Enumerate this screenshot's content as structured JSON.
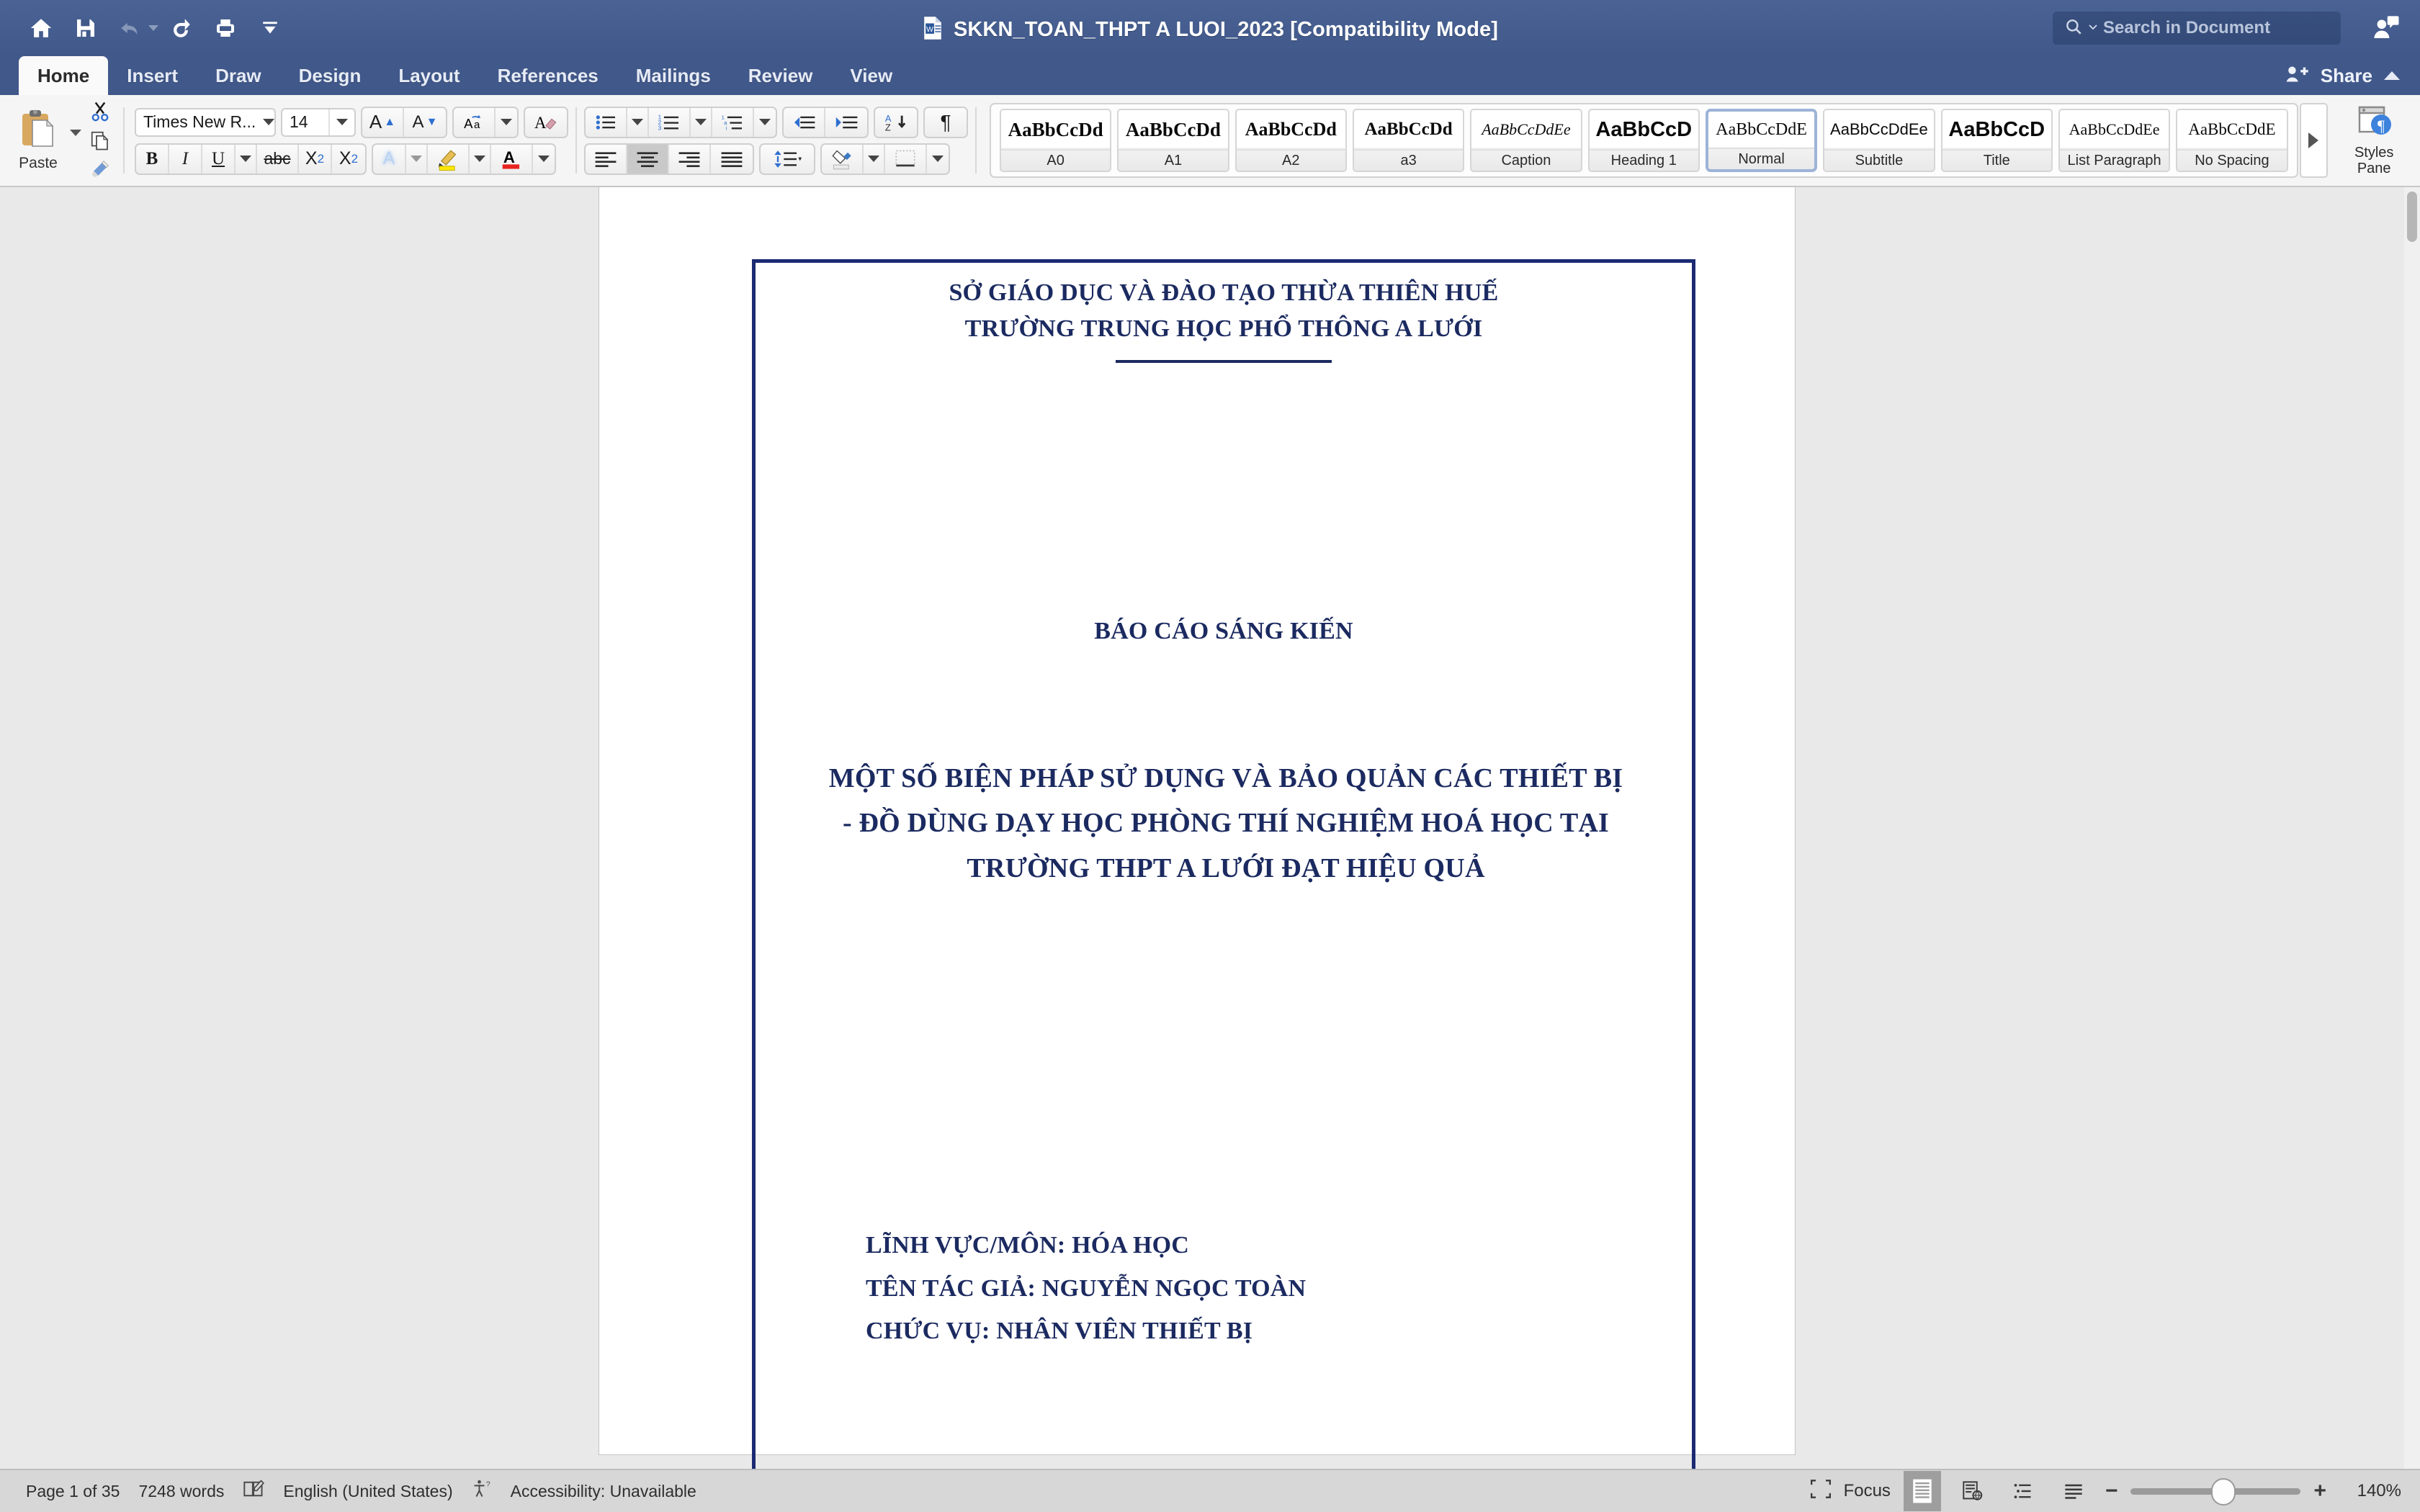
{
  "titlebar": {
    "quick_access": [
      {
        "name": "home-icon",
        "label": "Home"
      },
      {
        "name": "save-icon",
        "label": "Save"
      },
      {
        "name": "undo-icon",
        "label": "Undo"
      },
      {
        "name": "redo-icon",
        "label": "Redo"
      },
      {
        "name": "print-icon",
        "label": "Print"
      },
      {
        "name": "customize-toolbar-icon",
        "label": "Customize Quick Access Toolbar"
      }
    ],
    "document_title": "SKKN_TOAN_THPT A LUOI_2023 [Compatibility Mode]",
    "search_placeholder": "Search in Document",
    "account_icon": "account-icon"
  },
  "tabs": [
    {
      "label": "Home",
      "active": true
    },
    {
      "label": "Insert",
      "active": false
    },
    {
      "label": "Draw",
      "active": false
    },
    {
      "label": "Design",
      "active": false
    },
    {
      "label": "Layout",
      "active": false
    },
    {
      "label": "References",
      "active": false
    },
    {
      "label": "Mailings",
      "active": false
    },
    {
      "label": "Review",
      "active": false
    },
    {
      "label": "View",
      "active": false
    }
  ],
  "share": {
    "label": "Share",
    "collapse_icon": "chevron-up-icon"
  },
  "ribbon": {
    "clipboard": {
      "paste_label": "Paste",
      "cut_label": "Cut",
      "copy_label": "Copy",
      "format_painter_label": "Format Painter"
    },
    "font": {
      "font_name": "Times New R...",
      "font_size": "14",
      "grow_label": "Grow Font",
      "shrink_label": "Shrink Font",
      "change_case_label": "Change Case",
      "clear_formatting_label": "Clear Formatting",
      "bold_label": "B",
      "italic_label": "I",
      "underline_label": "U",
      "strikethrough_label": "abc",
      "subscript_label": "X",
      "subscript_sub": "2",
      "superscript_label": "X",
      "superscript_sup": "2",
      "text_effects_label": "A",
      "highlight_color": "#ffe800",
      "font_color": "#e8231f"
    },
    "paragraph": {
      "bullets_label": "Bullets",
      "numbering_label": "Numbering",
      "multilevel_label": "Multilevel List",
      "decrease_indent_label": "Decrease Indent",
      "increase_indent_label": "Increase Indent",
      "sort_label": "Sort",
      "show_marks_label": "¶",
      "align_left_label": "Align Left",
      "align_center_label": "Center",
      "align_right_label": "Align Right",
      "justify_label": "Justify",
      "line_spacing_label": "Line Spacing",
      "shading_label": "Shading",
      "borders_label": "Borders",
      "active_alignment": "Center"
    },
    "styles": [
      {
        "preview": "AaBbCcDd",
        "name": "A0",
        "selected": false,
        "font": "serif",
        "weight": "bold",
        "style": "normal",
        "size": "27px"
      },
      {
        "preview": "AaBbCcDd",
        "name": "A1",
        "selected": false,
        "font": "serif",
        "weight": "bold",
        "style": "normal",
        "size": "27px"
      },
      {
        "preview": "AaBbCcDd",
        "name": "A2",
        "selected": false,
        "font": "serif",
        "weight": "bold",
        "style": "normal",
        "size": "26px"
      },
      {
        "preview": "AaBbCcDd",
        "name": "a3",
        "selected": false,
        "font": "serif",
        "weight": "bold",
        "style": "normal",
        "size": "25px"
      },
      {
        "preview": "AaBbCcDdEe",
        "name": "Caption",
        "selected": false,
        "font": "serif",
        "weight": "normal",
        "style": "italic",
        "size": "22px"
      },
      {
        "preview": "AaBbCcD",
        "name": "Heading 1",
        "selected": false,
        "font": "sans",
        "weight": "bold",
        "style": "normal",
        "size": "29px"
      },
      {
        "preview": "AaBbCcDdE",
        "name": "Normal",
        "selected": true,
        "font": "serif",
        "weight": "normal",
        "style": "normal",
        "size": "24px"
      },
      {
        "preview": "AaBbCcDdEe",
        "name": "Subtitle",
        "selected": false,
        "font": "sans",
        "weight": "normal",
        "style": "normal",
        "size": "22px"
      },
      {
        "preview": "AaBbCcD",
        "name": "Title",
        "selected": false,
        "font": "sans",
        "weight": "bold",
        "style": "normal",
        "size": "29px"
      },
      {
        "preview": "AaBbCcDdEe",
        "name": "List Paragraph",
        "selected": false,
        "font": "serif",
        "weight": "normal",
        "style": "normal",
        "size": "22px"
      },
      {
        "preview": "AaBbCcDdE",
        "name": "No Spacing",
        "selected": false,
        "font": "serif",
        "weight": "normal",
        "style": "normal",
        "size": "23px"
      }
    ],
    "gallery_next_label": "More styles",
    "styles_pane": {
      "line1": "Styles",
      "line2": "Pane"
    }
  },
  "document": {
    "header_line1": "SỞ GIÁO DỤC VÀ ĐÀO TẠO THỪA THIÊN HUẾ",
    "header_line2": "TRƯỜNG TRUNG HỌC PHỔ THÔNG A LƯỚI",
    "report_label": "BÁO CÁO SÁNG KIẾN",
    "title_line1": "MỘT SỐ BIỆN PHÁP SỬ DỤNG VÀ BẢO QUẢN CÁC THIẾT BỊ",
    "title_line2": "- ĐỒ DÙNG DẠY HỌC PHÒNG THÍ NGHIỆM HOÁ HỌC TẠI",
    "title_line3": "TRƯỜNG THPT A LƯỚI ĐẠT HIỆU QUẢ",
    "field_label": "LĨNH VỰC/MÔN: HÓA HỌC",
    "author_label": "TÊN TÁC GIẢ: NGUYỄN NGỌC TOÀN",
    "position_label": "CHỨC VỤ: NHÂN VIÊN THIẾT BỊ",
    "border_color": "#1b2a72",
    "text_color": "#1b2a60"
  },
  "statusbar": {
    "page_info": "Page 1 of 35",
    "word_count": "7248 words",
    "proofing_icon": "proofing-icon",
    "language": "English (United States)",
    "accessibility_icon": "accessibility-icon",
    "accessibility": "Accessibility: Unavailable",
    "focus_label": "Focus",
    "focus_icon": "focus-icon",
    "view_print_layout_icon": "print-layout-icon",
    "view_web_layout_icon": "web-layout-icon",
    "view_outline_icon": "outline-icon",
    "view_draft_icon": "draft-icon",
    "zoom_out_label": "−",
    "zoom_in_label": "+",
    "zoom_level": "140%"
  }
}
